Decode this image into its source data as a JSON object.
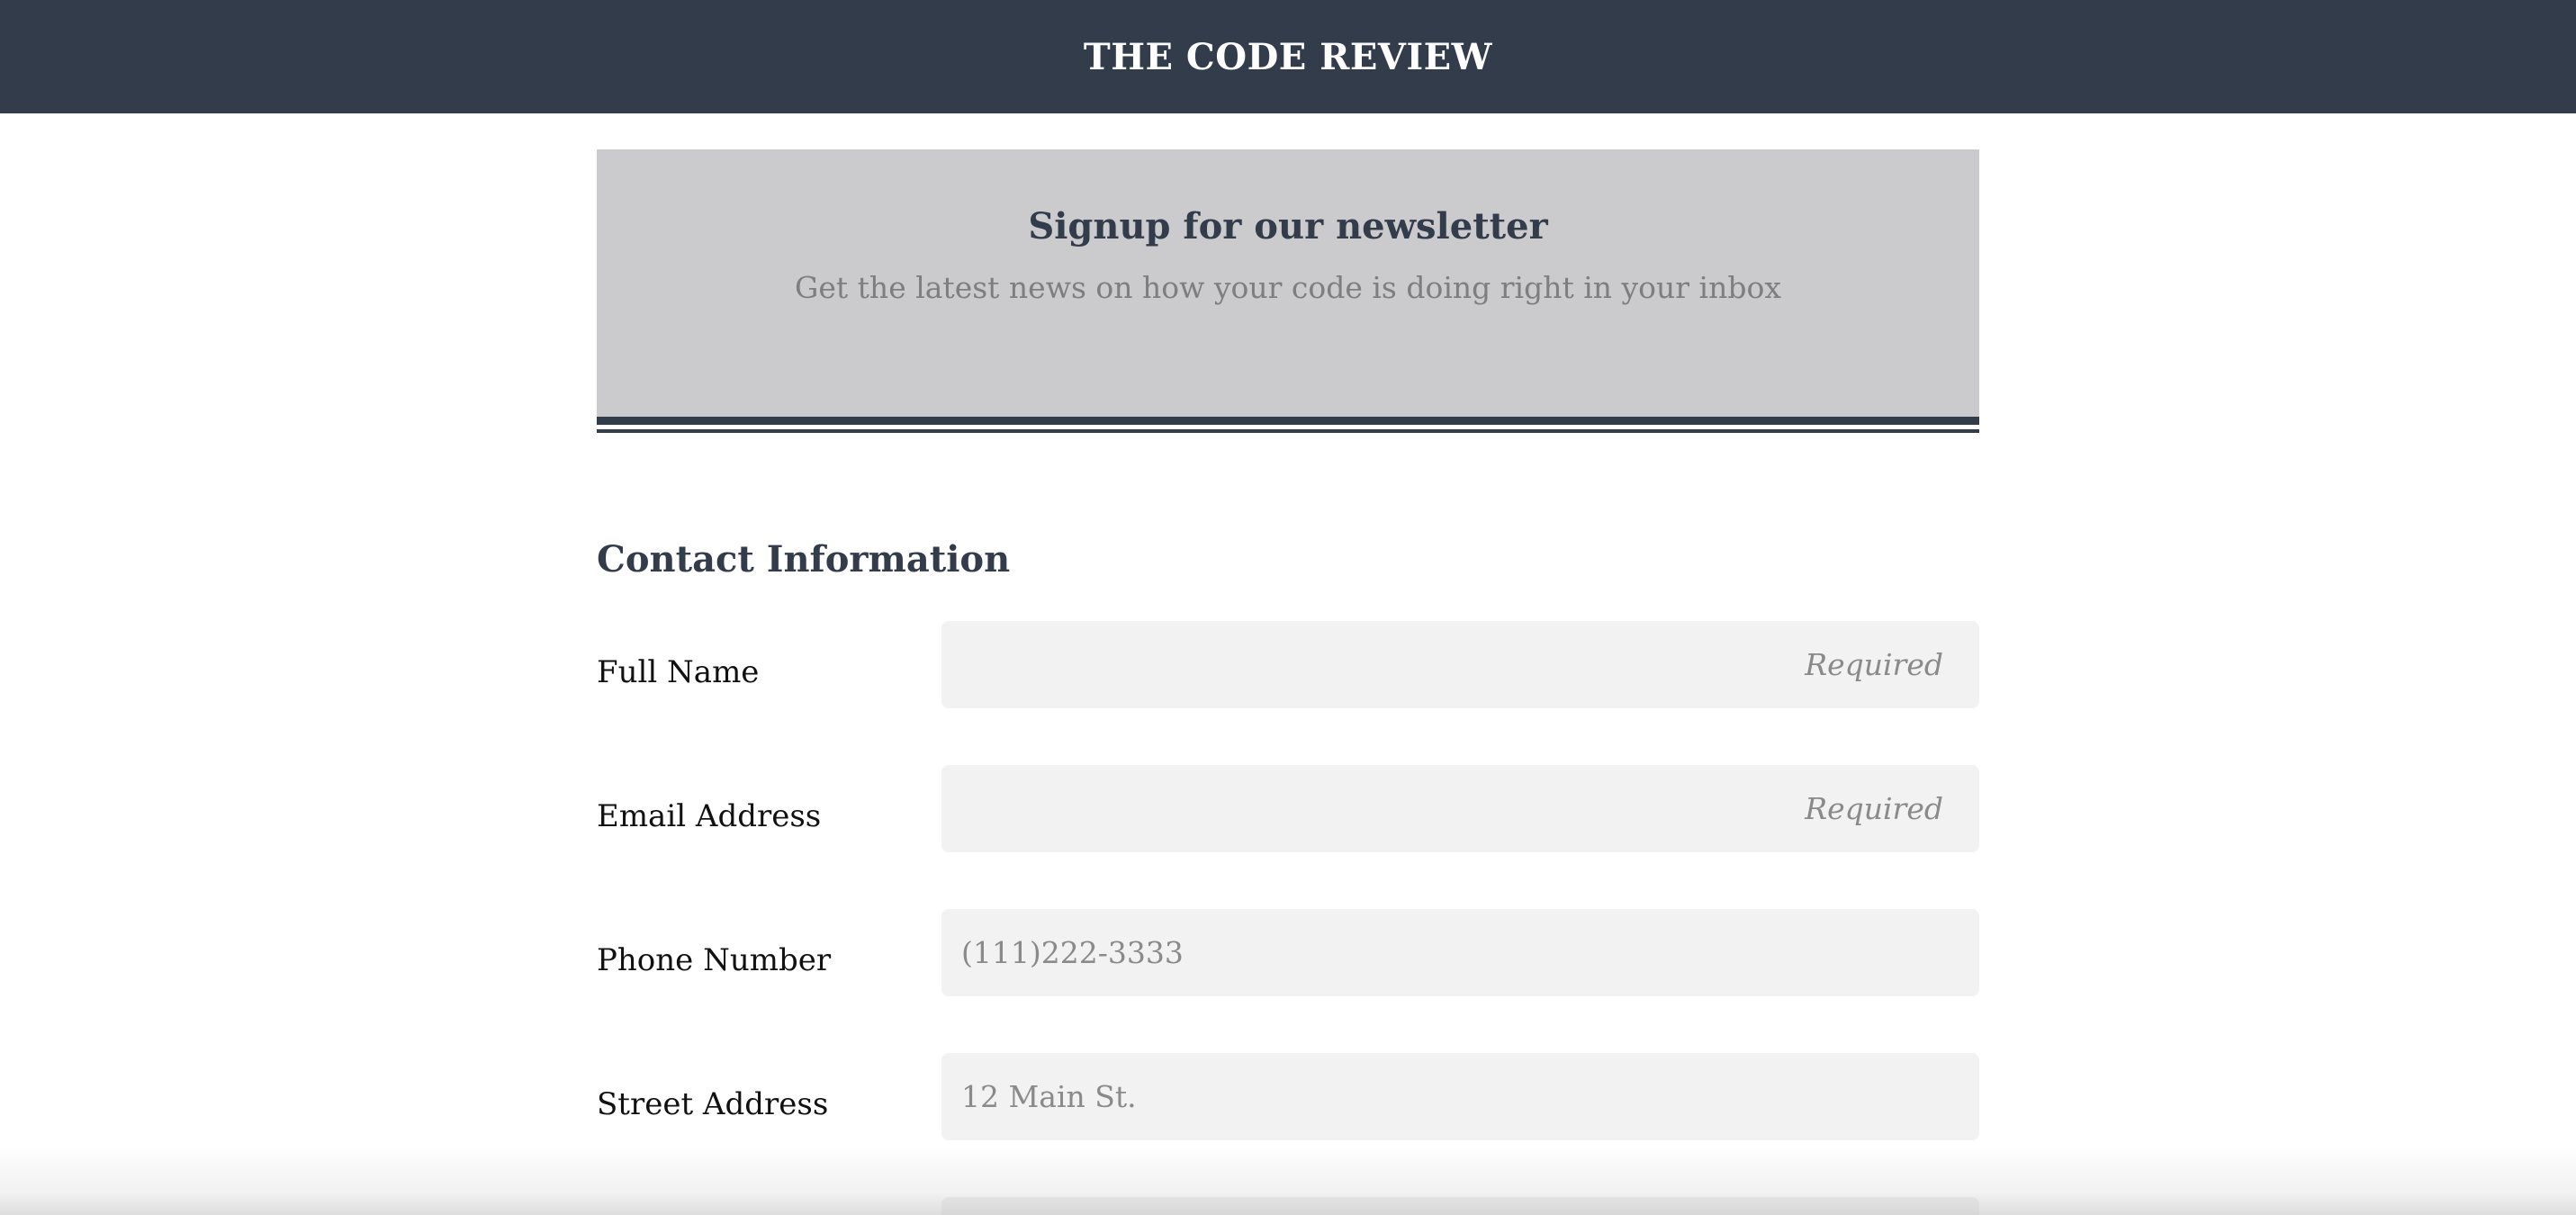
{
  "header": {
    "title": "THE CODE REVIEW",
    "background_color": "#333c4b"
  },
  "hero": {
    "title": "Signup for our newsletter",
    "subtitle": "Get the latest news on how your code is doing right in your inbox",
    "background_color": "#cbcacd"
  },
  "contact_section": {
    "title": "Contact Information",
    "fields": [
      {
        "label": "Full Name",
        "placeholder": "Required"
      },
      {
        "label": "Email Address",
        "placeholder": "Required"
      },
      {
        "label": "Phone Number",
        "placeholder": "(111)222-3333"
      },
      {
        "label": "Street Address",
        "placeholder": "12 Main St."
      }
    ]
  }
}
